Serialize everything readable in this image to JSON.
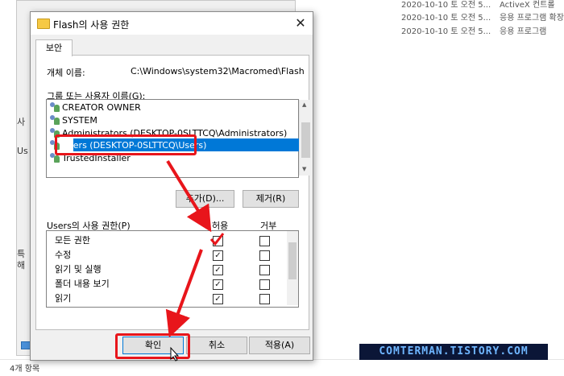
{
  "background": {
    "rows": [
      {
        "date": "2020-10-10 토 오전 5...",
        "type": "ActiveX 컨트롤"
      },
      {
        "date": "2020-10-10 토 오전 5...",
        "type": "응용 프로그램 확장"
      },
      {
        "date": "2020-10-10 토 오전 5...",
        "type": "응용 프로그램"
      }
    ],
    "status": "4개 항목",
    "left_labels": [
      "사",
      "Us",
      "특",
      "해"
    ]
  },
  "dialog": {
    "title": "Flash의 사용 권한",
    "tab": "보안",
    "object_name_label": "개체 이름:",
    "object_name_value": "C:\\Windows\\system32\\Macromed\\Flash",
    "group_label": "그룹 또는 사용자 이름(G):",
    "users": [
      {
        "name": "CREATOR OWNER"
      },
      {
        "name": "SYSTEM"
      },
      {
        "name": "Administrators (DESKTOP-0SLTTCQ\\Administrators)"
      },
      {
        "name": "Users (DESKTOP-0SLTTCQ\\Users)"
      },
      {
        "name": "TrustedInstaller"
      }
    ],
    "selected_user_index": 3,
    "add_button": "추가(D)...",
    "remove_button": "제거(R)",
    "perm_label": "Users의 사용 권한(P)",
    "allow_header": "허용",
    "deny_header": "거부",
    "permissions": [
      {
        "name": "모든 권한",
        "allow": true,
        "deny": false
      },
      {
        "name": "수정",
        "allow": true,
        "deny": false
      },
      {
        "name": "읽기 및 실행",
        "allow": true,
        "deny": false
      },
      {
        "name": "폴더 내용 보기",
        "allow": true,
        "deny": false
      },
      {
        "name": "읽기",
        "allow": true,
        "deny": false
      }
    ],
    "ok_button": "확인",
    "cancel_button": "취소",
    "apply_button": "적용(A)",
    "close_glyph": "✕"
  },
  "watermark": "COMTERMAN.TISTORY.COM",
  "colors": {
    "annotation": "#e8151b",
    "selection": "#0078d7",
    "watermark_bg": "#0b1637"
  }
}
